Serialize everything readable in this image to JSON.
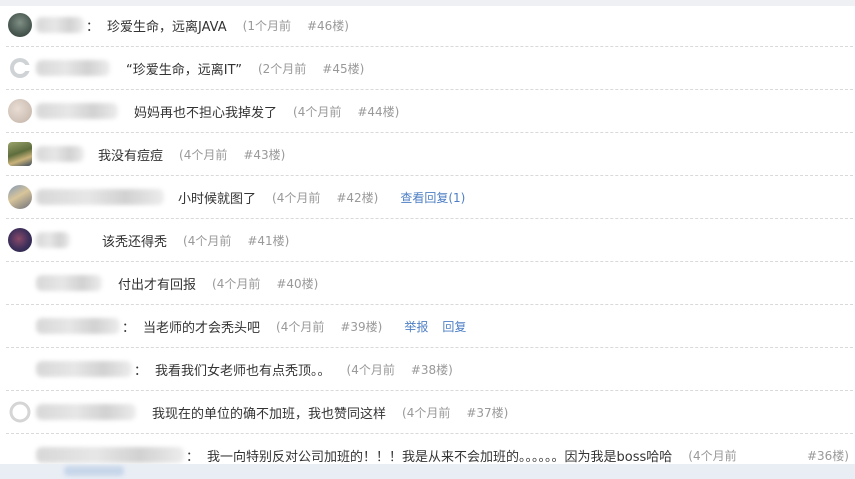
{
  "comments": [
    {
      "content": "珍爱生命，远离JAVA",
      "time": "(1个月前",
      "floor": "#46楼)",
      "avatar": "avatar-dark",
      "name_width": 48,
      "colon": "："
    },
    {
      "content": "“珍爱生命，远离IT”",
      "time": "(2个月前",
      "floor": "#45楼)",
      "avatar": "avatar-c-logo",
      "name_width": 74,
      "colon": ""
    },
    {
      "content": "妈妈再也不担心我掉发了",
      "time": "(4个月前",
      "floor": "#44楼)",
      "avatar": "avatar-light",
      "name_width": 82,
      "colon": ""
    },
    {
      "content": "我没有痘痘",
      "time": "(4个月前",
      "floor": "#43楼)",
      "avatar": "avatar-photo",
      "name_width": 48,
      "colon": ""
    },
    {
      "content": "小时候就图了",
      "time": "(4个月前",
      "floor": "#42楼)",
      "avatar": "avatar-photo2",
      "name_width": 128,
      "colon": "",
      "links": [
        "查看回复(1)"
      ]
    },
    {
      "content": "该秃还得秃",
      "time": "(4个月前",
      "floor": "#41楼)",
      "avatar": "avatar-purple",
      "name_width": 34,
      "colon": ""
    },
    {
      "content": "付出才有回报",
      "time": "(4个月前",
      "floor": "#40楼)",
      "avatar": "avatar-blank",
      "name_width": 66,
      "colon": ""
    },
    {
      "content": "当老师的才会秃头吧",
      "time": "(4个月前",
      "floor": "#39楼)",
      "avatar": "avatar-blank",
      "name_width": 84,
      "colon": "：",
      "links": [
        "举报",
        "回复"
      ]
    },
    {
      "content": "我看我们女老师也有点秃顶。。",
      "time": "(4个月前",
      "floor": "#38楼)",
      "avatar": "avatar-blank",
      "name_width": 96,
      "colon": "："
    },
    {
      "content": "我现在的单位的确不加班，我也赞同这样",
      "time": "(4个月前",
      "floor": "#37楼)",
      "avatar": "avatar-ring",
      "name_width": 100,
      "colon": ""
    },
    {
      "content": "我一向特别反对公司加班的！！！我是从来不会加班的。。。。。。因为我是boss哈哈",
      "time": "(4个月前",
      "floor": "#36楼)",
      "avatar": "avatar-blank",
      "name_width": 148,
      "colon": "：",
      "floor_right": true
    }
  ]
}
